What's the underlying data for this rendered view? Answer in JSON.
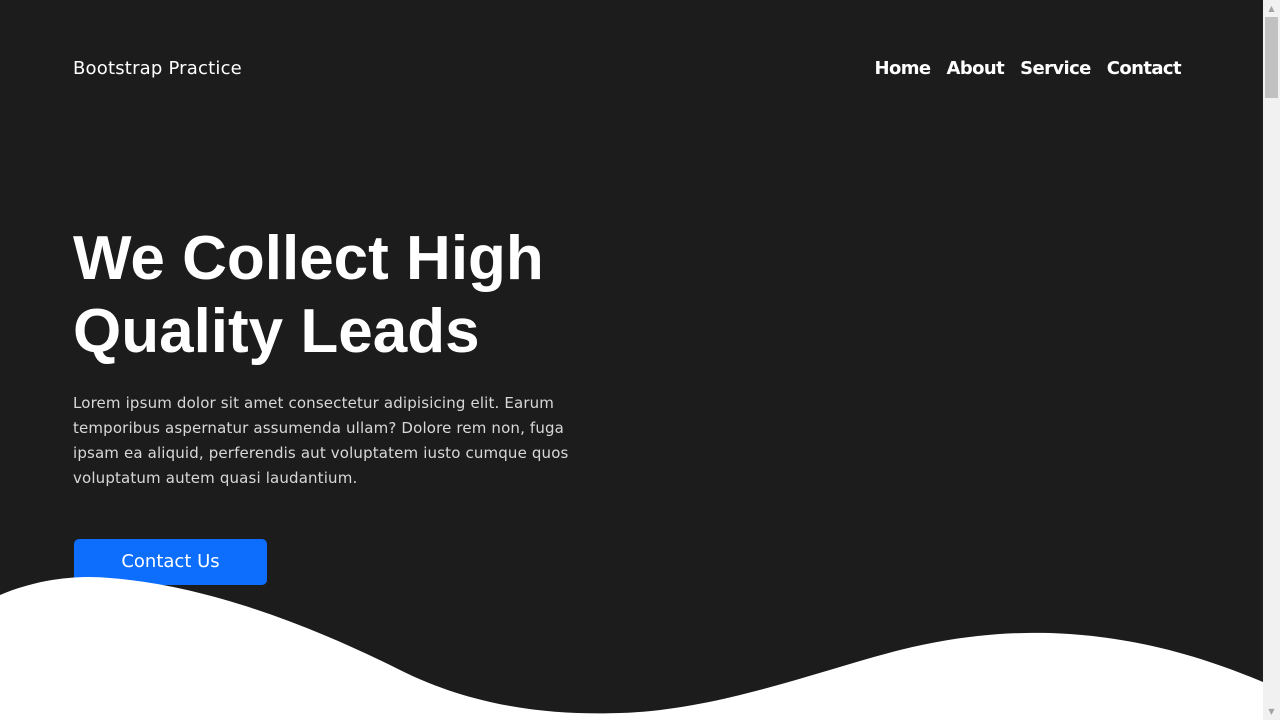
{
  "navbar": {
    "brand": "Bootstrap Practice",
    "links": [
      {
        "label": "Home"
      },
      {
        "label": "About"
      },
      {
        "label": "Service"
      },
      {
        "label": "Contact"
      }
    ]
  },
  "hero": {
    "title_line1": "We Collect High",
    "title_line2": "Quality Leads",
    "description": "Lorem ipsum dolor sit amet consectetur adipisicing elit. Earum temporibus aspernatur assumenda ullam? Dolore rem non, fuga ipsam ea aliquid, perferendis aut voluptatem iusto cumque quos voluptatum autem quasi laudantium.",
    "cta_label": "Contact Us"
  },
  "colors": {
    "background": "#1c1c1c",
    "accent": "#0d6efd",
    "wave": "#ffffff"
  },
  "scrollbar": {
    "up_icon": "chevron-up-icon",
    "down_icon": "chevron-down-icon"
  }
}
